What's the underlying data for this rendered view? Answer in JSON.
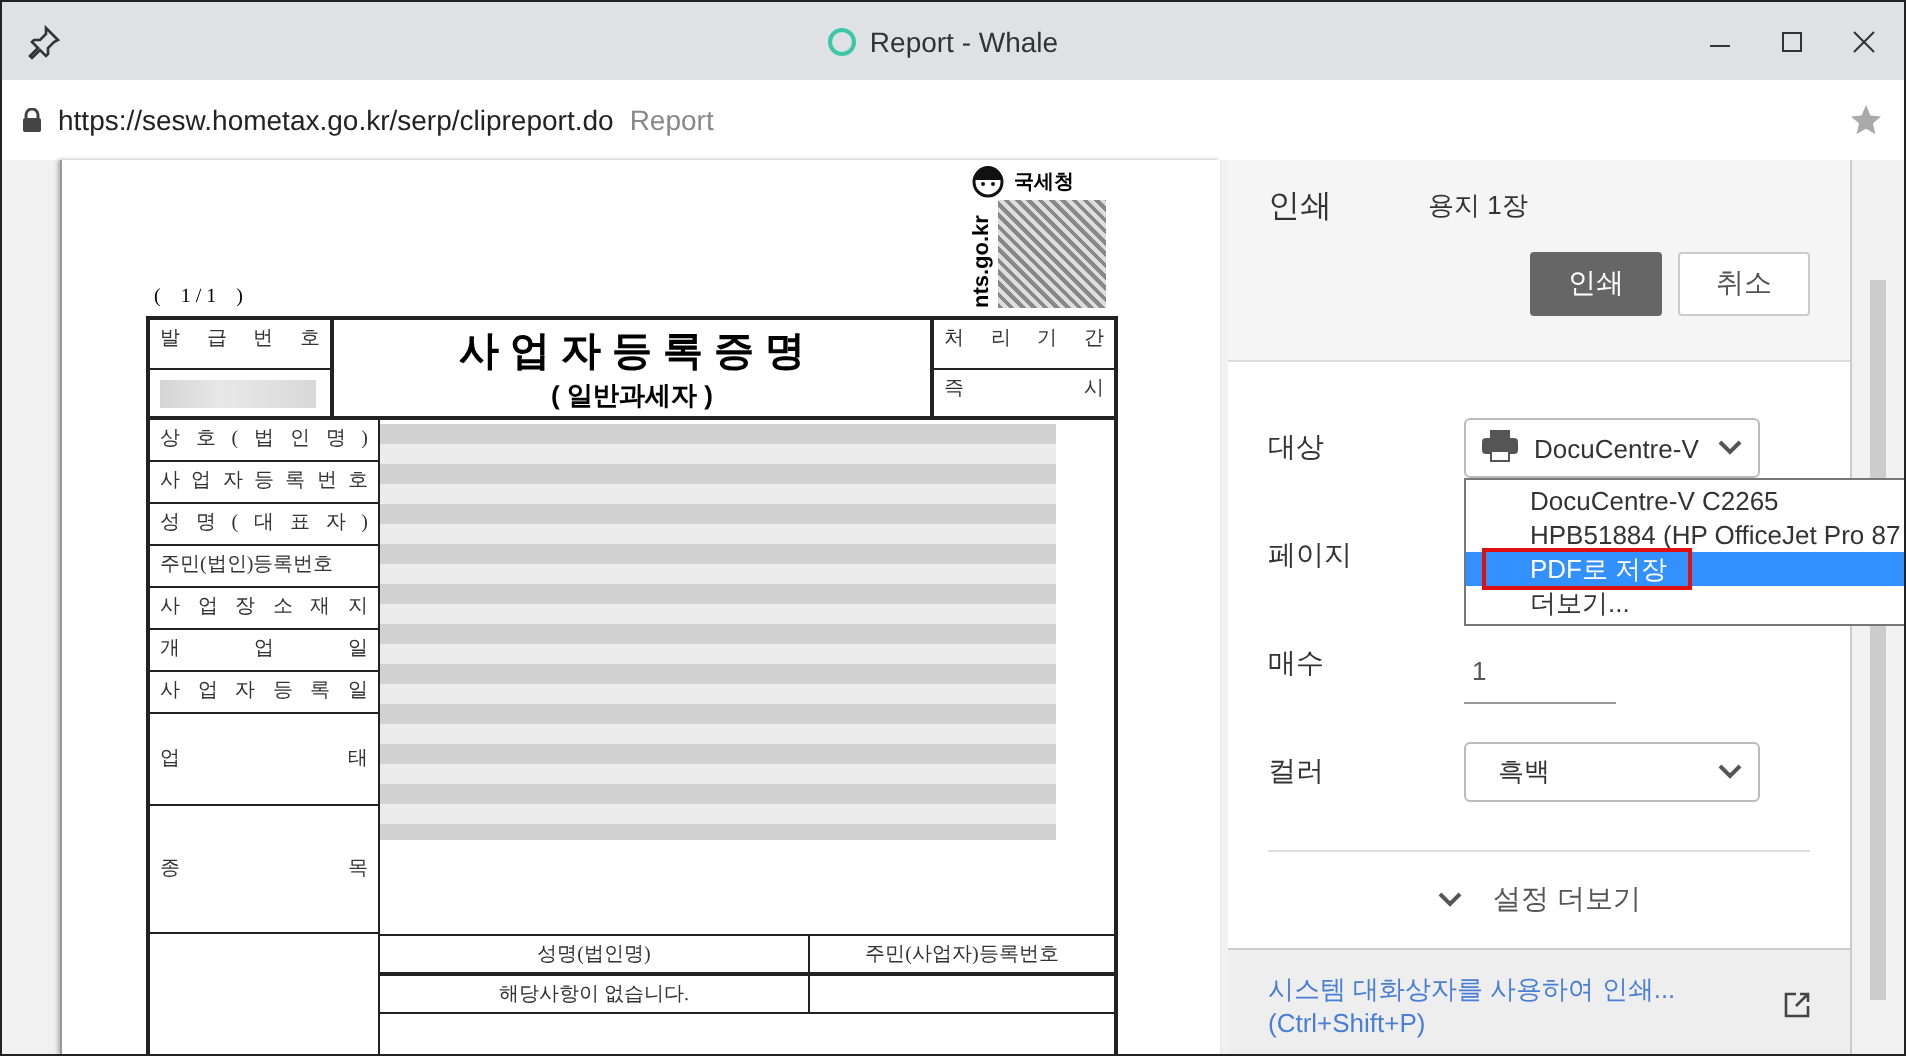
{
  "window": {
    "title": "Report - Whale"
  },
  "address_bar": {
    "url": "https://sesw.hometax.go.kr/serp/clipreport.do",
    "page_title": "Report"
  },
  "document": {
    "page_indicator": "(    1 / 1    )",
    "agency": "국세청",
    "site": "nts.go.kr",
    "title": "사 업 자 등 록 증 명",
    "subtitle": "( 일반과세자 )",
    "issue_label": "발 급 번 호",
    "period_label": "처 리 기 간",
    "period_value": "즉 시",
    "rows": [
      {
        "label": "상 호 ( 법 인 명 )",
        "kind": "line"
      },
      {
        "label": "사 업 자 등 록 번 호",
        "kind": "line"
      },
      {
        "label": "성 명 ( 대 표 자 )",
        "kind": "line"
      },
      {
        "label": "주민(법인)등록번호",
        "kind": "line"
      },
      {
        "label": "사 업 장 소 재 지",
        "kind": "line"
      },
      {
        "label": "개 업 일",
        "kind": "line"
      },
      {
        "label": "사 업 자 등 록 일",
        "kind": "line"
      },
      {
        "label": "업 태",
        "kind": "double"
      },
      {
        "label": "종 목",
        "kind": "triple"
      }
    ],
    "bottom_table": {
      "columns": [
        "성명(법인명)",
        "주민(사업자)등록번호"
      ],
      "empty_message": "해당사항이 없습니다."
    }
  },
  "print_panel": {
    "title": "인쇄",
    "sheets": "용지 1장",
    "buttons": [
      {
        "label": "인쇄",
        "kind": "primary"
      },
      {
        "label": "취소",
        "kind": "secondary"
      }
    ],
    "destination": {
      "label": "대상",
      "value": "DocuCentre-V",
      "expanded": true,
      "options": [
        {
          "label": "DocuCentre-V C2265",
          "selected": false
        },
        {
          "label": "HPB51884 (HP OfficeJet Pro 87",
          "selected": false
        },
        {
          "label": "PDF로 저장",
          "selected": true
        },
        {
          "label": "더보기...",
          "selected": false
        }
      ]
    },
    "pages": {
      "label": "페이지"
    },
    "copies": {
      "label": "매수",
      "value": "1"
    },
    "color": {
      "label": "컬러",
      "value": "흑백"
    },
    "more_settings": "설정 더보기",
    "system_dialog": {
      "link": "시스템 대화상자를 사용하여 인쇄...",
      "shortcut": "(Ctrl+Shift+P)"
    }
  }
}
